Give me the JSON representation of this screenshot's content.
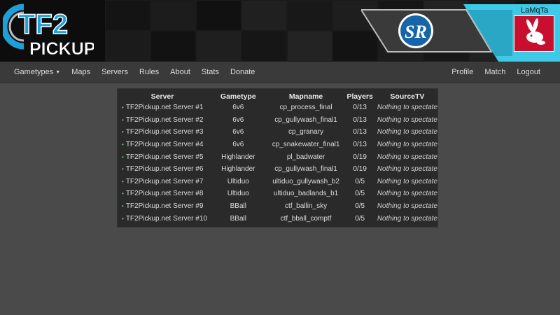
{
  "header": {
    "logo_text_top": "TF2",
    "logo_text_bottom": "PICKUP",
    "sponsor_text": "SR",
    "username": "LaMqTa"
  },
  "nav": {
    "left": [
      {
        "label": "Gametypes",
        "dropdown": true
      },
      {
        "label": "Maps"
      },
      {
        "label": "Servers"
      },
      {
        "label": "Rules"
      },
      {
        "label": "About"
      },
      {
        "label": "Stats"
      },
      {
        "label": "Donate"
      }
    ],
    "right": [
      {
        "label": "Profile"
      },
      {
        "label": "Match"
      },
      {
        "label": "Logout"
      }
    ]
  },
  "table": {
    "headers": {
      "server": "Server",
      "gametype": "Gametype",
      "mapname": "Mapname",
      "players": "Players",
      "sourcetv": "SourceTV"
    },
    "rows": [
      {
        "server": "TF2Pickup.net Server #1",
        "gametype": "6v6",
        "map": "cp_process_final",
        "players": "0/13",
        "stv": "Nothing to spectate"
      },
      {
        "server": "TF2Pickup.net Server #2",
        "gametype": "6v6",
        "map": "cp_gullywash_final1",
        "players": "0/13",
        "stv": "Nothing to spectate"
      },
      {
        "server": "TF2Pickup.net Server #3",
        "gametype": "6v6",
        "map": "cp_granary",
        "players": "0/13",
        "stv": "Nothing to spectate"
      },
      {
        "server": "TF2Pickup.net Server #4",
        "gametype": "6v6",
        "map": "cp_snakewater_final1",
        "players": "0/13",
        "stv": "Nothing to spectate"
      },
      {
        "server": "TF2Pickup.net Server #5",
        "gametype": "Highlander",
        "map": "pl_badwater",
        "players": "0/19",
        "stv": "Nothing to spectate"
      },
      {
        "server": "TF2Pickup.net Server #6",
        "gametype": "Highlander",
        "map": "cp_gullywash_final1",
        "players": "0/19",
        "stv": "Nothing to spectate"
      },
      {
        "server": "TF2Pickup.net Server #7",
        "gametype": "Ultiduo",
        "map": "ultiduo_gullywash_b2",
        "players": "0/5",
        "stv": "Nothing to spectate"
      },
      {
        "server": "TF2Pickup.net Server #8",
        "gametype": "Ultiduo",
        "map": "ultiduo_badlands_b1",
        "players": "0/5",
        "stv": "Nothing to spectate"
      },
      {
        "server": "TF2Pickup.net Server #9",
        "gametype": "BBall",
        "map": "ctf_ballin_sky",
        "players": "0/5",
        "stv": "Nothing to spectate"
      },
      {
        "server": "TF2Pickup.net Server #10",
        "gametype": "BBall",
        "map": "ctf_bball_comptf",
        "players": "0/5",
        "stv": "Nothing to spectate"
      }
    ]
  },
  "colors": {
    "brand_blue": "#1e9fd8",
    "sponsor_cyan": "#3ec9e6",
    "avatar_red": "#c8102e",
    "status_green": "#7fc97f"
  },
  "icons": {
    "bullet": "•",
    "caret": "▼"
  }
}
